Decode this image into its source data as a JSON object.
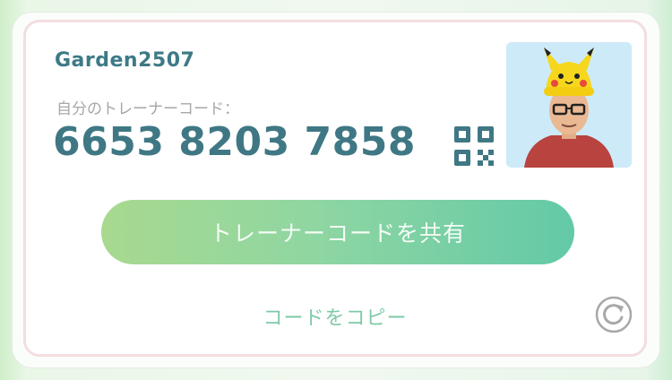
{
  "trainer": {
    "username": "Garden2507",
    "code_label": "自分のトレーナーコード：",
    "code": "6653 8203 7858"
  },
  "actions": {
    "share_label": "トレーナーコードを共有",
    "copy_label": "コードをコピー"
  },
  "icons": {
    "qr": "qr-code-icon",
    "refresh": "refresh-icon",
    "avatar": "trainer-avatar"
  },
  "colors": {
    "accent_teal": "#3f7884",
    "button_start": "#a8d98f",
    "button_end": "#63c9a7",
    "copy_text": "#7ecaa6",
    "label_gray": "#a7a7a7"
  }
}
